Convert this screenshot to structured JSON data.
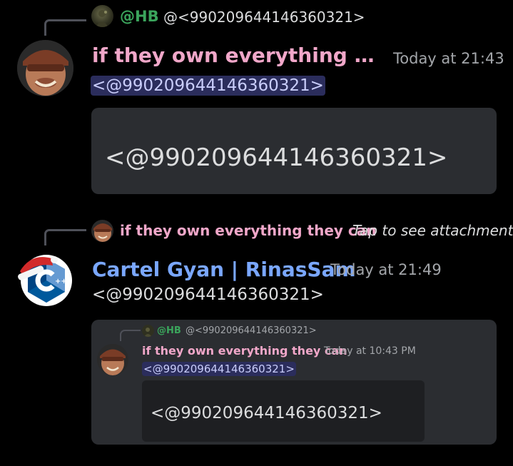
{
  "message1": {
    "reply": {
      "author": "@HB",
      "author_color": "#3ba55c",
      "content": "@<990209644146360321>"
    },
    "author": "if they own everything they ...",
    "author_color": "#f1a7c9",
    "timestamp": "Today at 21:43",
    "mention": "<@990209644146360321>",
    "embed_text": "<@990209644146360321>"
  },
  "message2": {
    "reply": {
      "author": "if they own everything they can",
      "author_color": "#f1a7c9",
      "content": "Tap to see attachment"
    },
    "author": "Cartel Gyan | RinasSam",
    "author_color": "#7aa7ff",
    "timestamp": "Today at 21:49",
    "content": "<@990209644146360321>",
    "nested": {
      "reply_author": "@HB",
      "reply_content": "@<990209644146360321>",
      "author": "if they own everything they can",
      "timestamp": "Today at 10:43 PM",
      "mention": "<@990209644146360321>",
      "box_text": "<@990209644146360321>"
    }
  },
  "colors": {
    "background": "#000000",
    "text": "#dcddde",
    "muted": "#a3a6aa",
    "mention_bg": "#2b2d5c",
    "mention_text": "#c9cdfb",
    "embed_bg": "#2b2d31"
  }
}
